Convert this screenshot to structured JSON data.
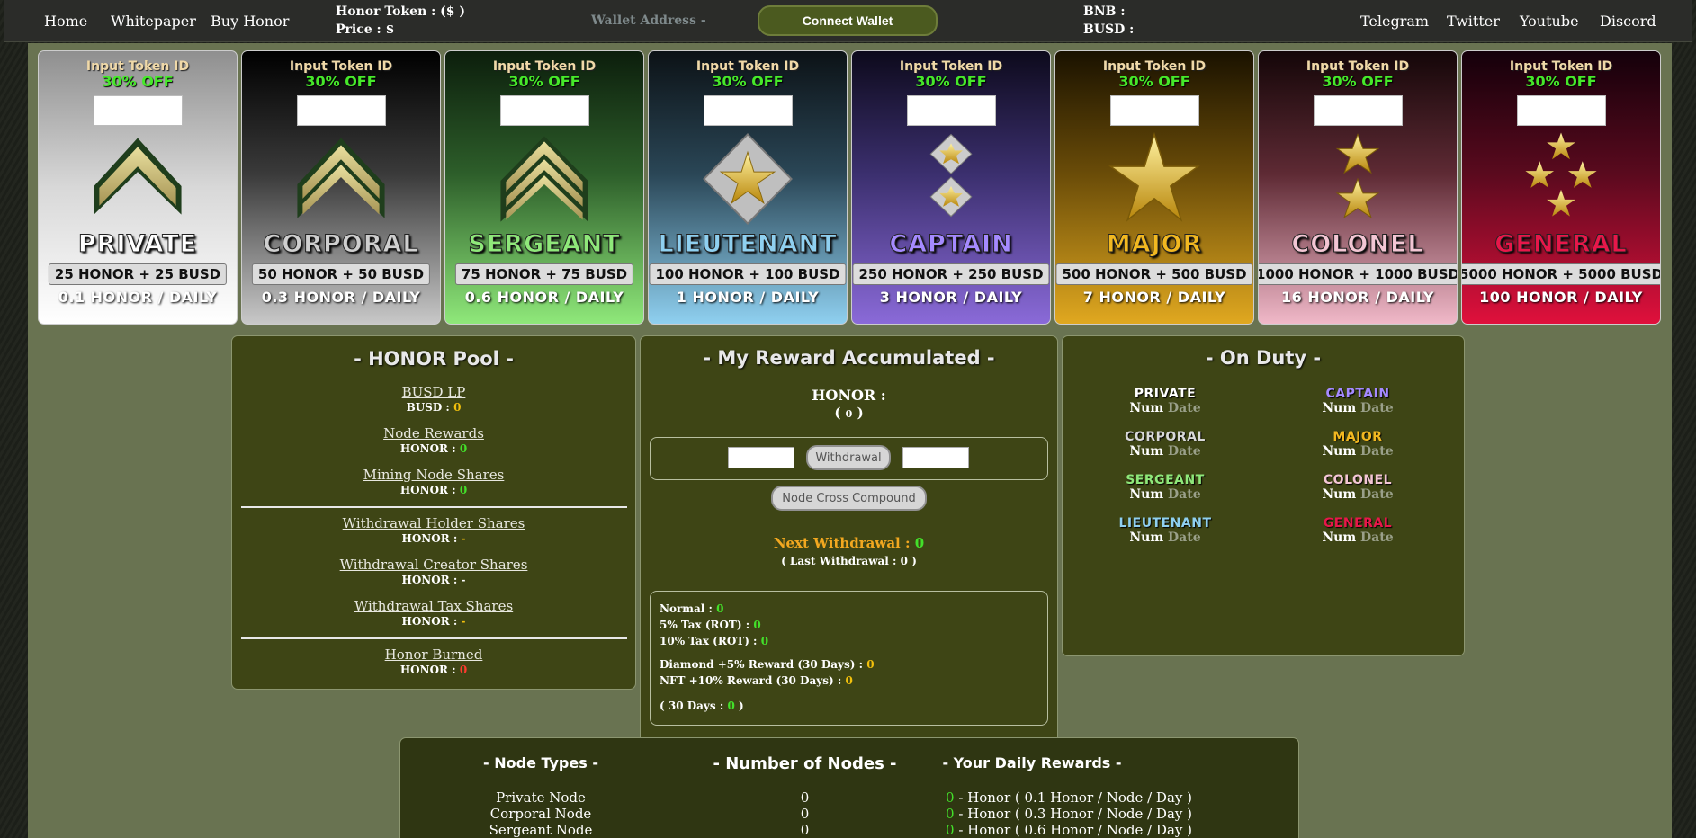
{
  "nav": {
    "home": "Home",
    "whitepaper": "Whitepaper",
    "buy_honor": "Buy Honor",
    "honor_token": "Honor Token : ($ )",
    "price": "Price : $",
    "wallet": "Wallet Address -",
    "connect": "Connect Wallet",
    "bnb": "BNB :",
    "busd": "BUSD :",
    "telegram": "Telegram",
    "twitter": "Twitter",
    "youtube": "Youtube",
    "discord": "Discord"
  },
  "cards": [
    {
      "input_label": "Input Token ID",
      "discount": "30% OFF",
      "rank": "PRIVATE",
      "price": "25 HONOR + 25 BUSD",
      "daily": "0.1 HONOR / DAILY",
      "insignia": "private-chevron-icon"
    },
    {
      "input_label": "Input Token ID",
      "discount": "30% OFF",
      "rank": "CORPORAL",
      "price": "50 HONOR + 50 BUSD",
      "daily": "0.3 HONOR / DAILY",
      "insignia": "corporal-chevron-icon"
    },
    {
      "input_label": "Input Token ID",
      "discount": "30% OFF",
      "rank": "SERGEANT",
      "price": "75 HONOR + 75 BUSD",
      "daily": "0.6 HONOR / DAILY",
      "insignia": "sergeant-chevron-icon"
    },
    {
      "input_label": "Input Token ID",
      "discount": "30% OFF",
      "rank": "LIEUTENANT",
      "price": "100 HONOR + 100 BUSD",
      "daily": "1 HONOR / DAILY",
      "insignia": "lieutenant-star-icon"
    },
    {
      "input_label": "Input Token ID",
      "discount": "30% OFF",
      "rank": "CAPTAIN",
      "price": "250 HONOR + 250 BUSD",
      "daily": "3 HONOR / DAILY",
      "insignia": "captain-stars-icon"
    },
    {
      "input_label": "Input Token ID",
      "discount": "30% OFF",
      "rank": "MAJOR",
      "price": "500 HONOR + 500 BUSD",
      "daily": "7 HONOR / DAILY",
      "insignia": "major-star-icon"
    },
    {
      "input_label": "Input Token ID",
      "discount": "30% OFF",
      "rank": "COLONEL",
      "price": "1000 HONOR + 1000 BUSD",
      "daily": "16 HONOR / DAILY",
      "insignia": "colonel-stars-icon"
    },
    {
      "input_label": "Input Token ID",
      "discount": "30% OFF",
      "rank": "GENERAL",
      "price": "5000 HONOR + 5000 BUSD",
      "daily": "100 HONOR / DAILY",
      "insignia": "general-stars-icon"
    }
  ],
  "pool": {
    "title": "- HONOR Pool -",
    "busd_lp": "BUSD LP",
    "busd_label": "BUSD :",
    "busd_val": "0",
    "node_rewards": "Node Rewards",
    "nr_label": "HONOR :",
    "nr_val": "0",
    "mining": "Mining Node Shares",
    "mn_label": "HONOR :",
    "mn_val": "0",
    "whs": "Withdrawal Holder Shares",
    "whs_label": "HONOR :",
    "whs_val": "-",
    "wcs": "Withdrawal Creator Shares",
    "wcs_label": "HONOR :",
    "wcs_val": "-",
    "wts": "Withdrawal Tax Shares",
    "wts_label": "HONOR :",
    "wts_val": "-",
    "burned": "Honor Burned",
    "b_label": "HONOR :",
    "b_val": "0"
  },
  "reward": {
    "title": "- My Reward Accumulated -",
    "honor_label": "HONOR :",
    "honor_open": "(",
    "honor_val": "0",
    "honor_close": ")",
    "withdrawal": "Withdrawal",
    "compound": "Node Cross Compound",
    "next_label": "Next Withdrawal :",
    "next_val": "0",
    "last_open": "( Last Withdrawal :",
    "last_val": "0",
    "last_close": ")",
    "normal_label": "Normal :",
    "normal_val": "0",
    "tax5_label": "5% Tax (ROT) :",
    "tax5_val": "0",
    "tax10_label": "10% Tax (ROT) :",
    "tax10_val": "0",
    "diamond_label": "Diamond +5% Reward (30 Days) :",
    "diamond_val": "0",
    "nft_label": "NFT +10% Reward (30 Days) :",
    "nft_val": "0",
    "days_open": "( 30 Days :",
    "days_val": "0",
    "days_close": ")"
  },
  "duty": {
    "title": "- On Duty -",
    "num": "Num",
    "date": "Date",
    "ranks": [
      "PRIVATE",
      "CORPORAL",
      "SERGEANT",
      "LIEUTENANT",
      "CAPTAIN",
      "MAJOR",
      "COLONEL",
      "GENERAL"
    ]
  },
  "nodes": {
    "types_title": "- Node Types -",
    "count_title": "- Number of Nodes -",
    "rewards_title": "- Your Daily Rewards -",
    "rows": [
      {
        "type": "Private Node",
        "count": "0",
        "reward": "0",
        "rate": " - Honor ( 0.1 Honor / Node / Day )"
      },
      {
        "type": "Corporal Node",
        "count": "0",
        "reward": "0",
        "rate": " - Honor ( 0.3 Honor / Node / Day )"
      },
      {
        "type": "Sergeant Node",
        "count": "0",
        "reward": "0",
        "rate": " - Honor ( 0.6 Honor / Node / Day )"
      }
    ]
  },
  "colors": {
    "green": "#43e02a",
    "yellow": "#f2c00c",
    "red": "#ff3b2f",
    "private": "#ffffff",
    "corporal": "#d9d9d9",
    "sergeant": "#8fe87a",
    "lieutenant": "#8fd0f0",
    "captain": "#a58aff",
    "major": "#f2b820",
    "colonel": "#f3c6d4",
    "general": "#e8174a"
  }
}
